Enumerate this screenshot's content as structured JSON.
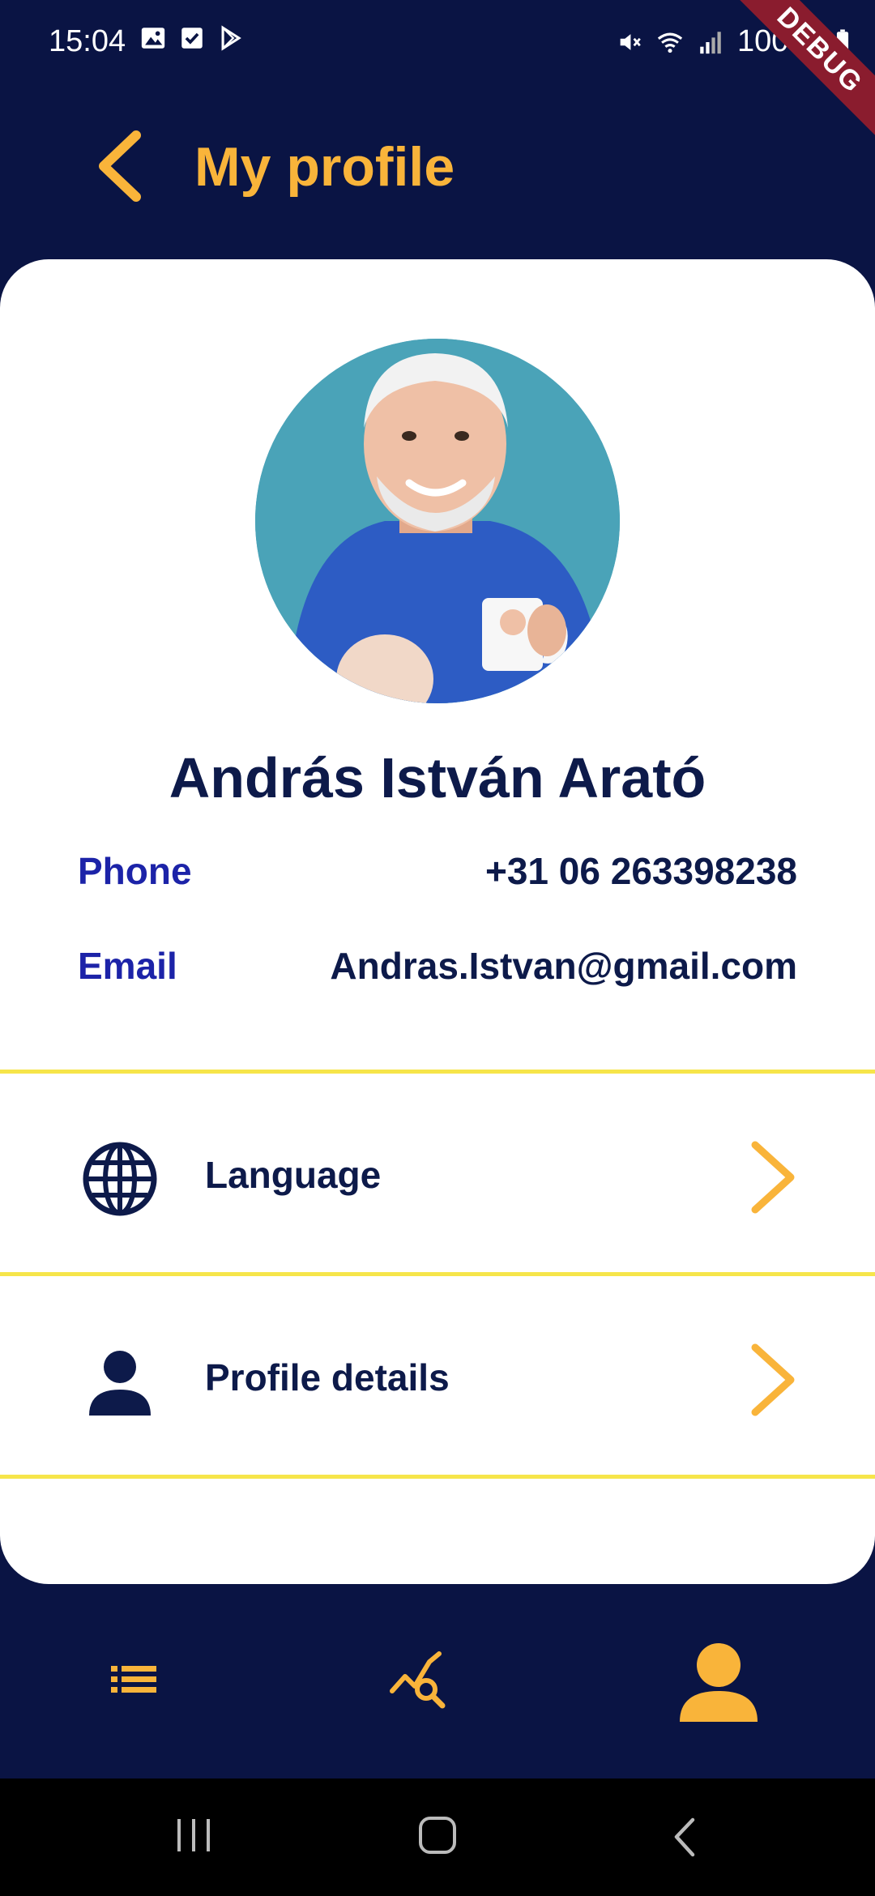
{
  "status_bar": {
    "time": "15:04",
    "battery": "100%",
    "left_icons": [
      "image-icon",
      "check-square-icon",
      "play-store-icon"
    ],
    "right_icons": [
      "mute-icon",
      "wifi-icon",
      "signal-icon",
      "battery-icon"
    ],
    "debug_banner": "DEBUG"
  },
  "app_bar": {
    "title": "My profile",
    "back_icon": "chevron-left-icon"
  },
  "profile": {
    "name": "András István Arató",
    "phone_label": "Phone",
    "phone_value": "+31 06 263398238",
    "email_label": "Email",
    "email_value": "Andras.Istvan@gmail.com"
  },
  "menu": {
    "items": [
      {
        "label": "Language",
        "icon": "globe-icon"
      },
      {
        "label": "Profile details",
        "icon": "person-icon"
      }
    ]
  },
  "bottom_nav": {
    "items": [
      "list-icon",
      "analytics-search-icon",
      "person-icon"
    ],
    "active": "person-icon"
  },
  "colors": {
    "background": "#0a1444",
    "accent": "#f9b43a",
    "label_blue": "#1c23a8",
    "divider": "#f6e54a",
    "text_dark": "#0d1a4a"
  }
}
